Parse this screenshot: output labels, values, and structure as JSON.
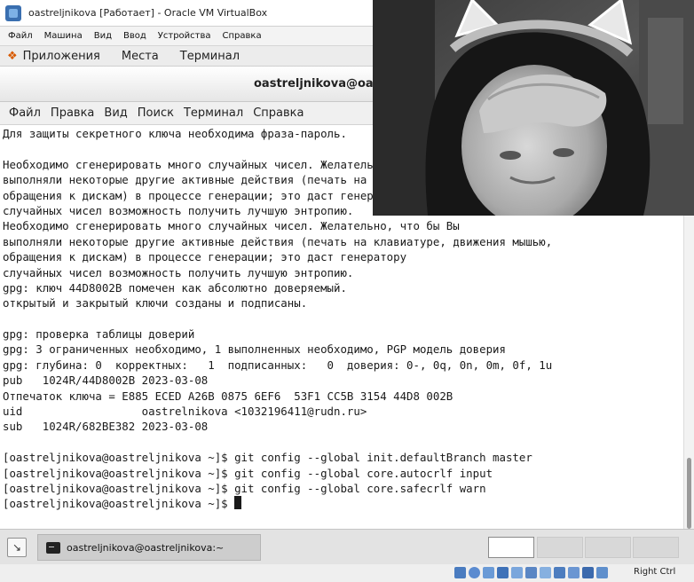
{
  "vbox": {
    "title": "oastreljnikova [Работает] - Oracle VM VirtualBox",
    "menu": [
      "Файл",
      "Машина",
      "Вид",
      "Ввод",
      "Устройства",
      "Справка"
    ]
  },
  "gnome_bar": {
    "items": [
      "Приложения",
      "Места",
      "Терминал"
    ]
  },
  "terminal": {
    "title": "oastreljnikova@oastreljnikova:~",
    "menu": [
      "Файл",
      "Правка",
      "Вид",
      "Поиск",
      "Терминал",
      "Справка"
    ],
    "lines": [
      "Для защиты секретного ключа необходима фраза-пароль.",
      "",
      "Необходимо сгенерировать много случайных чисел. Желательно, что бы Вы",
      "выполняли некоторые другие активные действия (печать на клавиатуре, движения мышью,",
      "обращения к дискам) в процессе генерации; это даст генератору",
      "случайных чисел возможность получить лучшую энтропию.",
      "Необходимо сгенерировать много случайных чисел. Желательно, что бы Вы",
      "выполняли некоторые другие активные действия (печать на клавиатуре, движения мышью,",
      "обращения к дискам) в процессе генерации; это даст генератору",
      "случайных чисел возможность получить лучшую энтропию.",
      "gpg: ключ 44D8002B помечен как абсолютно доверяемый.",
      "открытый и закрытый ключи созданы и подписаны.",
      "",
      "gpg: проверка таблицы доверий",
      "gpg: 3 ограниченных необходимо, 1 выполненных необходимо, PGP модель доверия",
      "gpg: глубина: 0  корректных:   1  подписанных:   0  доверия: 0-, 0q, 0n, 0m, 0f, 1u",
      "pub   1024R/44D8002B 2023-03-08",
      "Отпечаток ключа = E885 ECED A26B 0875 6EF6  53F1 CC5B 3154 44D8 002B",
      "uid                  oastrelnikova <1032196411@rudn.ru>",
      "sub   1024R/682BE382 2023-03-08",
      "",
      "[oastreljnikova@oastreljnikova ~]$ git config --global init.defaultBranch master",
      "[oastreljnikova@oastreljnikova ~]$ git config --global core.autocrlf input",
      "[oastreljnikova@oastreljnikova ~]$ git config --global core.safecrlf warn",
      "[oastreljnikova@oastreljnikova ~]$ "
    ]
  },
  "taskbar": {
    "task_label": "oastreljnikova@oastreljnikova:~"
  },
  "status": {
    "host_key": "Right Ctrl"
  }
}
